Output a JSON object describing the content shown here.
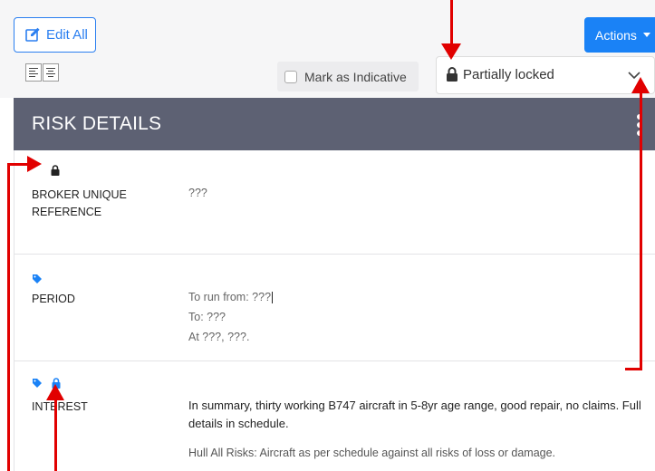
{
  "toolbar": {
    "edit_all_label": "Edit All",
    "actions_label": "Actions",
    "mark_indicative_label": "Mark as Indicative",
    "lock_status_label": "Partially locked"
  },
  "section": {
    "title": "RISK DETAILS"
  },
  "fields": [
    {
      "label_lines": [
        "BROKER UNIQUE",
        "REFERENCE"
      ],
      "value_lines": [
        "???"
      ]
    },
    {
      "label_lines": [
        "PERIOD"
      ],
      "value_lines": [
        "To run from: ???",
        "To: ???",
        "At ???, ???."
      ]
    },
    {
      "label_lines": [
        "INTEREST"
      ],
      "value_lines": [
        "In summary, thirty working B747 aircraft in 5-8yr age range, good repair, no claims. Full",
        "details in schedule.",
        "Hull All Risks: Aircraft as per schedule against all risks of loss or damage."
      ]
    }
  ],
  "colors": {
    "accent": "#1a82f6",
    "header_bg": "#5d6173",
    "annotation": "#e10000"
  },
  "icons": [
    "pencil-square-icon",
    "caret-down-icon",
    "align-left-icon",
    "align-center-icon",
    "lock-icon",
    "chevron-down-icon",
    "kebab-icon",
    "tag-icon"
  ]
}
